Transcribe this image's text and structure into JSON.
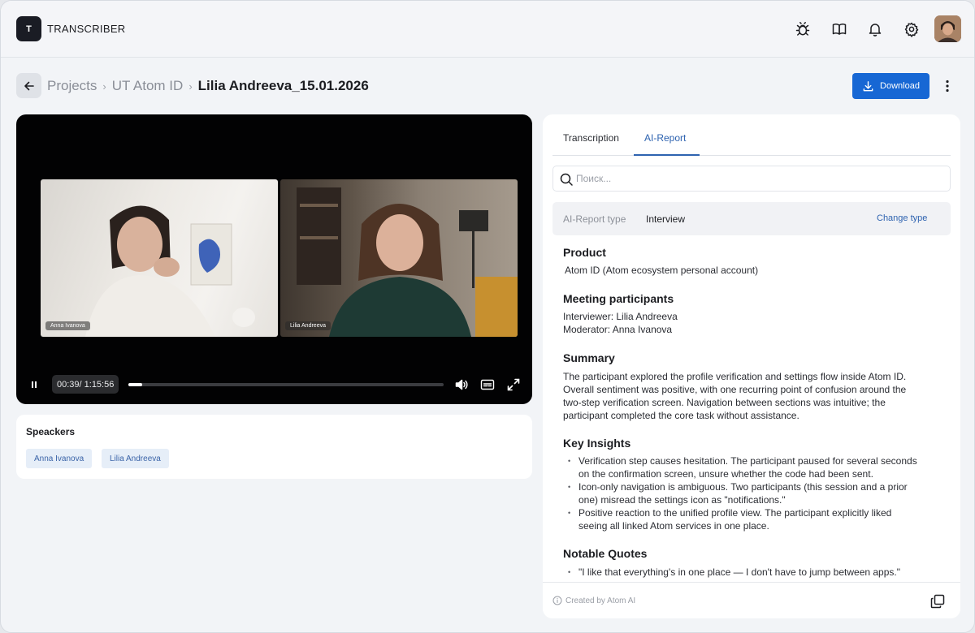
{
  "app": {
    "logo_letter": "T",
    "name": "TRANSCRIBER"
  },
  "header_icons": [
    "bug-icon",
    "book-icon",
    "bell-icon",
    "gear-icon",
    "avatar"
  ],
  "breadcrumb": {
    "items": [
      "Projects",
      "UT Atom ID"
    ],
    "current": "Lilia Andreeva_15.01.2026"
  },
  "actions": {
    "download_label": "Download"
  },
  "video": {
    "participants": [
      "Anna Ivanova",
      "Lilia Andreeva"
    ],
    "current_time": "00:39",
    "total_time": "1:15:56",
    "timecode": "00:39/ 1:15:56",
    "progress": 0.009
  },
  "speakers": {
    "title": "Speackers",
    "list": [
      "Anna Ivanova",
      "Lilia Andreeva"
    ]
  },
  "tabs": [
    {
      "label": "Transcription",
      "active": false
    },
    {
      "label": "AI-Report",
      "active": true
    }
  ],
  "search": {
    "placeholder": "Поиск...",
    "value": ""
  },
  "report_type": {
    "label": "AI-Report type",
    "value": "Interview",
    "change_label": "Change type"
  },
  "report": {
    "product": {
      "title": "Product",
      "text": "Atom ID (Atom ecosystem personal account)"
    },
    "participants": {
      "title": "Meeting participants",
      "lines": [
        "Interviewer: Lilia Andreeva",
        "Moderator: Anna Ivanova"
      ]
    },
    "summary": {
      "title": "Summary",
      "lines": [
        "The participant explored the profile verification and settings flow inside Atom ID.",
        "Overall sentiment was positive, with one recurring point of confusion around the",
        "two-step verification screen. Navigation between sections was intuitive; the",
        "participant completed the core task without assistance."
      ]
    },
    "insights": {
      "title": "Key Insights",
      "items": [
        [
          "Verification step causes hesitation. The participant paused for several seconds",
          "on the confirmation screen, unsure whether the code had been sent."
        ],
        [
          "Icon-only navigation is ambiguous. Two participants (this session and a prior",
          "one) misread the settings icon as \"notifications.\""
        ],
        [
          "Positive reaction to the unified profile view. The participant explicitly liked",
          "seeing all linked Atom services in one place."
        ]
      ]
    },
    "quotes": {
      "title": "Notable Quotes",
      "items": [
        "\"I like that everything's in one place — I don't have to jump between apps.\""
      ]
    }
  },
  "footer": {
    "note": "Created by Atom AI"
  },
  "colors": {
    "accent": "#1767d4",
    "link": "#2e63b0",
    "chip_bg": "#e6eef8",
    "chip_text": "#3b64a8"
  }
}
